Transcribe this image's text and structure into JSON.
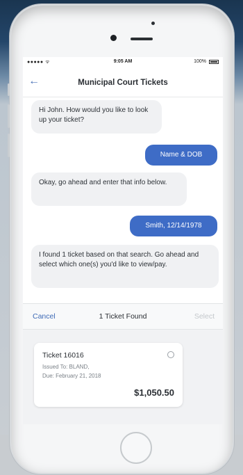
{
  "status_bar": {
    "carrier": "●●●●● ᯤ",
    "time": "9:05 AM",
    "battery": "100%"
  },
  "nav": {
    "back_icon": "←",
    "title": "Municipal Court Tickets"
  },
  "messages": [
    {
      "from": "bot",
      "text": "Hi John. How would you like to look up your ticket?"
    },
    {
      "from": "user",
      "text": "Name & DOB"
    },
    {
      "from": "bot",
      "text": "Okay, go ahead and enter that info below."
    },
    {
      "from": "user",
      "text": "Smith, 12/14/1978"
    },
    {
      "from": "bot",
      "text": "I found 1 ticket based on that search. Go ahead and select which one(s) you'd like to view/pay."
    }
  ],
  "sheet": {
    "cancel": "Cancel",
    "title": "1 Ticket Found",
    "select": "Select"
  },
  "ticket": {
    "title": "Ticket 16016",
    "issued_to": "Issued To: BLAND,",
    "due": "Due: February 21, 2018",
    "amount": "$1,050.50"
  },
  "colors": {
    "accent": "#3e6cc6",
    "bubble_in": "#f0f1f3"
  }
}
